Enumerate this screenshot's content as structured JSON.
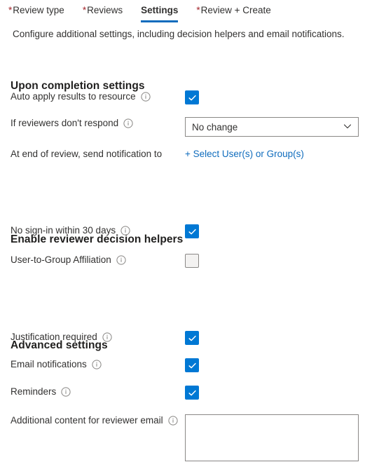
{
  "tabs": [
    {
      "label": "Review type",
      "required": true,
      "selected": false,
      "marker": "*"
    },
    {
      "label": "Reviews",
      "required": true,
      "selected": false,
      "marker": "*"
    },
    {
      "label": "Settings",
      "required": false,
      "selected": true,
      "marker": ""
    },
    {
      "label": "Review + Create",
      "required": true,
      "selected": false,
      "marker": "*"
    }
  ],
  "description": "Configure additional settings, including decision helpers and email notifications.",
  "sections": {
    "upon_completion": {
      "heading": "Upon completion settings",
      "auto_apply": {
        "label": "Auto apply results to resource",
        "info_icon": "info-icon",
        "checked": true,
        "checkbox_state": "checked"
      },
      "no_respond": {
        "label": "If reviewers don't respond",
        "info_icon": "info-icon",
        "selected_option": "No change",
        "chevron_icon": "chevron-down-icon"
      },
      "notification": {
        "label": "At end of review, send notification to",
        "link_label": "+ Select User(s) or Group(s)"
      }
    },
    "decision_helpers": {
      "heading": "Enable reviewer decision helpers",
      "no_signin": {
        "label": "No sign-in within 30 days",
        "info_icon": "info-icon",
        "checked": true,
        "checkbox_state": "checked"
      },
      "affiliation": {
        "label": "User-to-Group Affiliation",
        "info_icon": "info-icon",
        "checked": false,
        "checkbox_state": "unchecked"
      }
    },
    "advanced": {
      "heading": "Advanced settings",
      "justification": {
        "label": "Justification required",
        "info_icon": "info-icon",
        "checked": true,
        "checkbox_state": "checked"
      },
      "email_notifications": {
        "label": "Email notifications",
        "info_icon": "info-icon",
        "checked": true,
        "checkbox_state": "checked"
      },
      "reminders": {
        "label": "Reminders",
        "info_icon": "info-icon",
        "checked": true,
        "checkbox_state": "checked"
      },
      "additional_content": {
        "label": "Additional content for reviewer email",
        "info_icon": "info-icon",
        "value": "",
        "placeholder": ""
      }
    }
  },
  "colors": {
    "accent_blue": "#0078d4",
    "tab_underline": "#0f6cbd",
    "link_blue": "#0f6cbd",
    "required_asterisk": "#a4262c",
    "text": "#323130",
    "border_gray": "#8a8886",
    "unchecked_fill": "#f3f2f1"
  }
}
